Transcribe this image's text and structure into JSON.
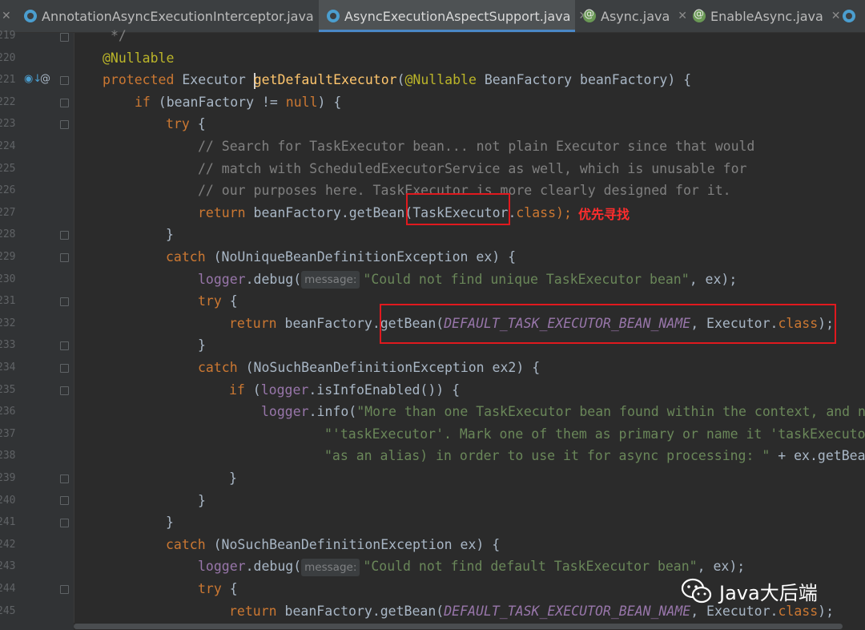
{
  "tabs": [
    {
      "label": "AnnotationAsyncExecutionInterceptor.java",
      "icon": "class-icon",
      "active": false
    },
    {
      "label": "AsyncExecutionAspectSupport.java",
      "icon": "class-icon",
      "active": true
    },
    {
      "label": "Async.java",
      "icon": "annotation-icon",
      "active": false
    },
    {
      "label": "EnableAsync.java",
      "icon": "annotation-icon",
      "active": false
    }
  ],
  "line_numbers": [
    "219",
    "220",
    "221",
    "222",
    "223",
    "224",
    "225",
    "226",
    "227",
    "228",
    "229",
    "230",
    "231",
    "232",
    "233",
    "234",
    "235",
    "236",
    "237",
    "238",
    "239",
    "240",
    "241",
    "242",
    "243",
    "244",
    "245"
  ],
  "code": {
    "l219": "*/",
    "l220": "@Nullable",
    "l221_kw": "protected",
    "l221_type": " Executor ",
    "l221_fn": "getDefaultExecutor",
    "l221_ann": "@Nullable",
    "l221_rest": " BeanFactory beanFactory) {",
    "l222_kw": "if",
    "l222_a": " (beanFactory != ",
    "l222_null": "null",
    "l222_b": ") {",
    "l223": "try",
    "l224": "// Search for TaskExecutor bean... not plain Executor since that would",
    "l225": "// match with ScheduledExecutorService as well, which is unusable for",
    "l226": "// our purposes here. TaskExecutor is more clearly designed for it.",
    "l227_kw": "return",
    "l227_a": " beanFactory.getBean(",
    "l227_b": "TaskExecutor.",
    "l227_cls": "class",
    "l227_c": ");",
    "l229_kw": "catch",
    "l229_rest": " (NoUniqueBeanDefinitionException ex) {",
    "l230_a": "logger",
    "l230_b": ".debug(",
    "l230_hint": "message:",
    "l230_str": "\"Could not find unique TaskExecutor bean\"",
    "l230_c": ", ex);",
    "l231": "try",
    "l232_kw": "return",
    "l232_a": " beanFactory.getBean(",
    "l232_const": "DEFAULT_TASK_EXECUTOR_BEAN_NAME",
    "l232_b": ", Executor.",
    "l232_cls": "class",
    "l232_c": ");",
    "l234_kw": "catch",
    "l234_rest": " (NoSuchBeanDefinitionException ex2) {",
    "l235_kw": "if",
    "l235_a": " (",
    "l235_logger": "logger",
    "l235_b": ".isInfoEnabled()) {",
    "l236_logger": "logger",
    "l236_a": ".info(",
    "l236_str": "\"More than one TaskExecutor bean found within the context, and no",
    "l237_str": "\"'taskExecutor'. Mark one of them as primary or name it 'taskExecutor",
    "l238_str": "\"as an alias) in order to use it for async processing: \"",
    "l238_rest": " + ex.getBean",
    "l242_kw": "catch",
    "l242_rest": " (NoSuchBeanDefinitionException ex) {",
    "l243_a": "logger",
    "l243_b": ".debug(",
    "l243_hint": "message:",
    "l243_str": "\"Could not find default TaskExecutor bean\"",
    "l243_c": ", ex);",
    "l244": "try",
    "l245_kw": "return",
    "l245_a": " beanFactory.getBean(",
    "l245_const": "DEFAULT_TASK_EXECUTOR_BEAN_NAME",
    "l245_b": ", Executor.",
    "l245_cls": "class",
    "l245_c": ");",
    "brace_open": " {",
    "brace_close": "}"
  },
  "annotation_note": "优先寻找",
  "watermark": "Java大后端",
  "colors": {
    "highlight_box": "#e0191e",
    "keyword": "#cc7832",
    "string": "#6a8759",
    "comment": "#808080",
    "constant": "#9876aa"
  }
}
